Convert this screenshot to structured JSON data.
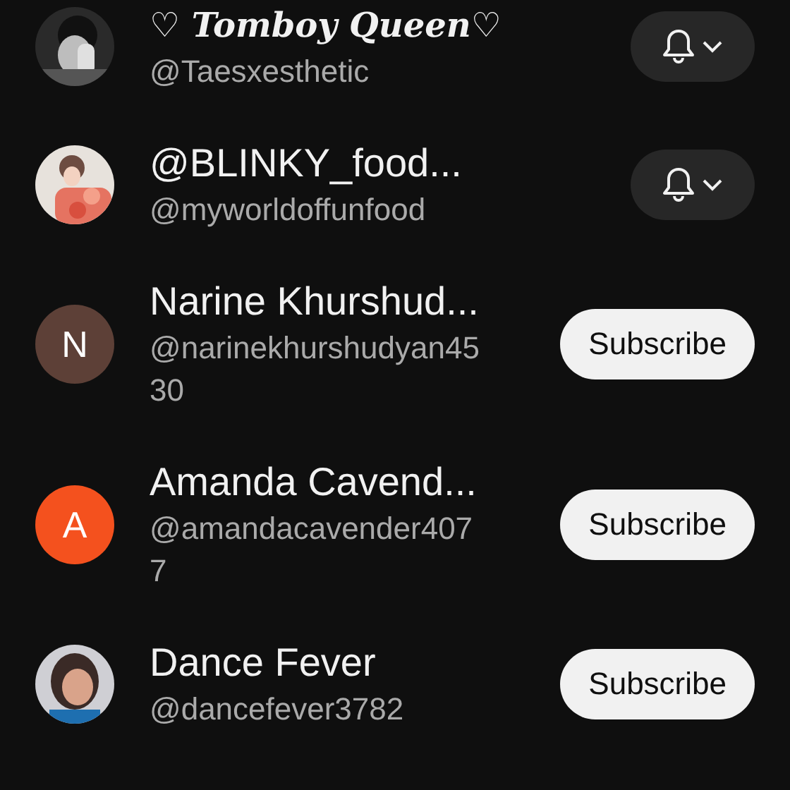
{
  "channels": [
    {
      "kind": "script",
      "name": "♡ Tomboy Queen♡",
      "handle": "@Taesxesthetic",
      "button": {
        "kind": "notify"
      }
    },
    {
      "kind": "plain",
      "name": "@BLINKY_food...",
      "handle": "@myworldoffunfood",
      "button": {
        "kind": "notify"
      }
    },
    {
      "kind": "plain",
      "name": "Narine Khurshud...",
      "handle": "@narinekhurshudyan45\n30",
      "avatar": {
        "kind": "letter",
        "letter": "N",
        "color": "#5d4037"
      },
      "button": {
        "kind": "subscribe",
        "label": "Subscribe"
      }
    },
    {
      "kind": "plain",
      "name": "Amanda Cavend...",
      "handle": "@amandacavender407\n7",
      "avatar": {
        "kind": "letter",
        "letter": "A",
        "color": "#f4511e"
      },
      "button": {
        "kind": "subscribe",
        "label": "Subscribe"
      }
    },
    {
      "kind": "plain",
      "name": "Dance Fever",
      "handle": "@dancefever3782",
      "button": {
        "kind": "subscribe",
        "label": "Subscribe"
      }
    }
  ]
}
